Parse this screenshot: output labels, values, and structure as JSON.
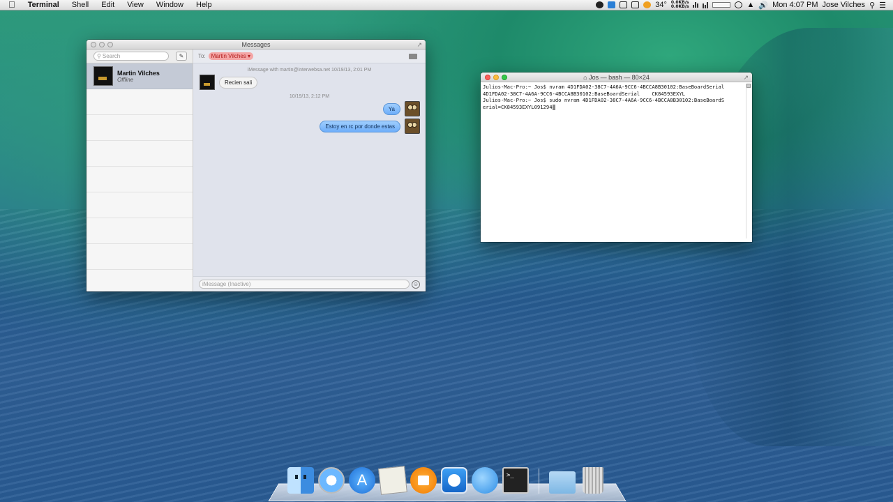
{
  "menubar": {
    "apple": "",
    "app_name": "Terminal",
    "menus": [
      "Shell",
      "Edit",
      "View",
      "Window",
      "Help"
    ],
    "temperature": "34°",
    "net_up": "0.0KB/s",
    "net_down": "0.0KB/s",
    "clock": "Mon 4:07 PM",
    "user": "Jose Vilches"
  },
  "messages": {
    "window_title": "Messages",
    "search_placeholder": "Search",
    "conversation": {
      "name": "Martin Vilches",
      "status": "Offline"
    },
    "to_label": "To:",
    "to_recipient": "Martin Vilches",
    "header_meta": "iMessage with martin@interwebsa.net 10/19/13, 2:01 PM",
    "incoming": "Recien sali",
    "timestamp": "10/19/13, 2:12 PM",
    "outgoing_1": "Ya",
    "outgoing_2": "Estoy en rc por donde estas",
    "input_placeholder": "iMessage (Inactive)"
  },
  "terminal": {
    "window_title": "Jos — bash — 80×24",
    "lines": [
      "Julios-Mac-Pro:~ Jos$ nvram 4D1FDA02-38C7-4A6A-9CC6-4BCCA8B30102:BaseBoardSerial",
      "4D1FDA02-38C7-4A6A-9CC6-4BCCA8B30102:BaseBoardSerial    CK84593EXYL",
      "Julios-Mac-Pro:~ Jos$ sudo nvram 4D1FDA02-38C7-4A6A-9CC6-4BCCA8B30102:BaseBoardS",
      "erial=CK84593EXYL091294"
    ]
  },
  "dock": {
    "items": [
      "finder-icon",
      "safari-icon",
      "app-store-icon",
      "preview-icon",
      "ibooks-icon",
      "teamviewer-icon",
      "messages-icon",
      "terminal-icon",
      "folder-icon",
      "trash-icon"
    ]
  }
}
